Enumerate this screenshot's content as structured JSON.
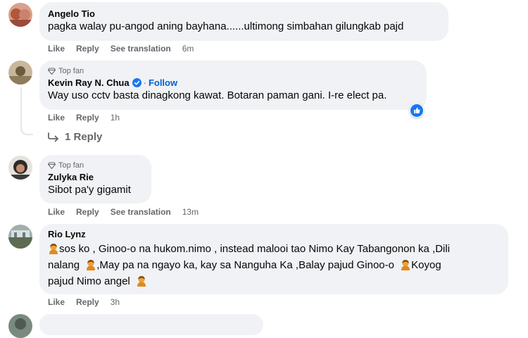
{
  "comments": [
    {
      "author": "Angelo Tio",
      "text": "pagka walay pu-angod aning bayhana......ultimong simbahan gilungkab pajd",
      "actions": {
        "like": "Like",
        "reply": "Reply",
        "translate": "See translation",
        "time": "6m"
      }
    },
    {
      "badge": "Top fan",
      "author": "Kevin Ray N. Chua",
      "follow": "Follow",
      "text": "Way uso cctv basta dinagkong kawat. Botaran paman gani. I-re elect pa.",
      "actions": {
        "like": "Like",
        "reply": "Reply",
        "time": "1h"
      },
      "replies_link": "1 Reply"
    },
    {
      "badge": "Top fan",
      "author": "Zulyka Rie",
      "text": "Sibot pa'y gigamit",
      "actions": {
        "like": "Like",
        "reply": "Reply",
        "translate": "See translation",
        "time": "13m"
      }
    },
    {
      "author": "Rio Lynz",
      "lines": [
        "sos ko , Ginoo-o na hukom.nimo , instead malooi tao Nimo Kay Tabangonon ka ,Dili",
        "nalang",
        ",May pa na ngayo ka, kay sa Nanguha Ka ,Balay pajud Ginoo-o",
        "Koyog",
        "pajud Nimo angel"
      ],
      "actions": {
        "like": "Like",
        "reply": "Reply",
        "time": "3h"
      }
    }
  ],
  "colors": {
    "bubble": "#f0f2f5",
    "meta": "#65676b",
    "link": "#0064d1",
    "like": "#1877f2"
  }
}
